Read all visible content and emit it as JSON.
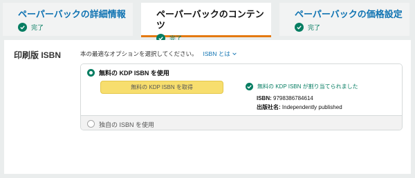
{
  "tabs": [
    {
      "title": "ペーパーバックの詳細情報",
      "status": "完了"
    },
    {
      "title": "ペーパーバックのコンテンツ",
      "status": "完了"
    },
    {
      "title": "ペーパーバックの価格設定",
      "status": "完了"
    }
  ],
  "active_tab": 1,
  "colors": {
    "link": "#0f73b2",
    "success": "#067d62",
    "accent": "#e47911",
    "button": "#f7de6e"
  },
  "isbn_section": {
    "title": "印刷版 ISBN",
    "intro": "本の最適なオプションを選択してください。",
    "help_link": "ISBN とは",
    "options": [
      {
        "label": "無料の KDP ISBN を使用",
        "selected": true
      },
      {
        "label": "独自の ISBN を使用",
        "selected": false
      }
    ],
    "get_button": "無料の KDP ISBN を取得",
    "assigned_message": "無料の KDP ISBN が割り当てられました",
    "isbn_label": "ISBN:",
    "isbn_value": "9798386784614",
    "publisher_label": "出版社名:",
    "publisher_value": "Independently published"
  }
}
